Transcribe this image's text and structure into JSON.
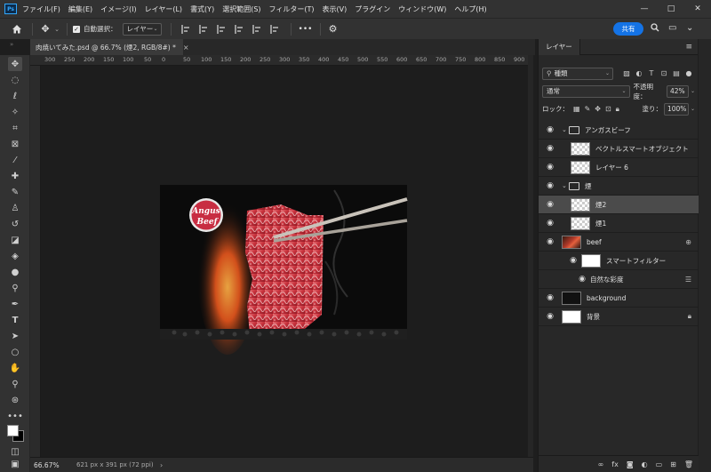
{
  "app": {
    "logo": "Ps",
    "menu": [
      "ファイル(F)",
      "編集(E)",
      "イメージ(I)",
      "レイヤー(L)",
      "書式(Y)",
      "選択範囲(S)",
      "フィルター(T)",
      "表示(V)",
      "プラグイン",
      "ウィンドウ(W)",
      "ヘルプ(H)"
    ],
    "window_controls": [
      "—",
      "□",
      "✕"
    ]
  },
  "options": {
    "home_icon": "home-icon",
    "move_tool_icon": "move-icon",
    "auto_select_label": "自動選択：",
    "auto_select_target": "レイヤー",
    "more_label": "•••",
    "share_label": "共有"
  },
  "document": {
    "tab_title": "肉焼いてみた.psd @ 66.7% (煙2, RGB/8#) *",
    "close": "×"
  },
  "rulers": {
    "horizontal": [
      "300",
      "250",
      "200",
      "150",
      "100",
      "50",
      "0",
      "50",
      "100",
      "150",
      "200",
      "250",
      "300",
      "350",
      "400",
      "450",
      "500",
      "550",
      "600",
      "650",
      "700",
      "750",
      "800",
      "850",
      "900"
    ]
  },
  "canvas": {
    "logo_text_1": "Angus",
    "logo_text_2": "Beef"
  },
  "status": {
    "zoom": "66.67%",
    "info": "621 px x 391 px (72 ppi)",
    "arrow": "›"
  },
  "panel": {
    "tab": "レイヤー",
    "menu": "≡",
    "filter_kind": "種類",
    "blend_mode": "通常",
    "opacity_label": "不透明度：",
    "opacity_value": "42%",
    "lock_label": "ロック：",
    "fill_label": "塗り：",
    "fill_value": "100%",
    "layers": [
      {
        "name": "アンガスビーフ",
        "type": "group"
      },
      {
        "name": "ベクトルスマートオブジェクト",
        "type": "smart"
      },
      {
        "name": "レイヤー 6",
        "type": "checker"
      },
      {
        "name": "煙",
        "type": "group"
      },
      {
        "name": "煙2",
        "type": "checker"
      },
      {
        "name": "煙1",
        "type": "checker"
      },
      {
        "name": "beef",
        "type": "beef"
      },
      {
        "name": "スマートフィルター",
        "type": "filter"
      },
      {
        "name": "自然な彩度",
        "type": "filter-item"
      },
      {
        "name": "background",
        "type": "black"
      },
      {
        "name": "背景",
        "type": "white"
      }
    ]
  }
}
